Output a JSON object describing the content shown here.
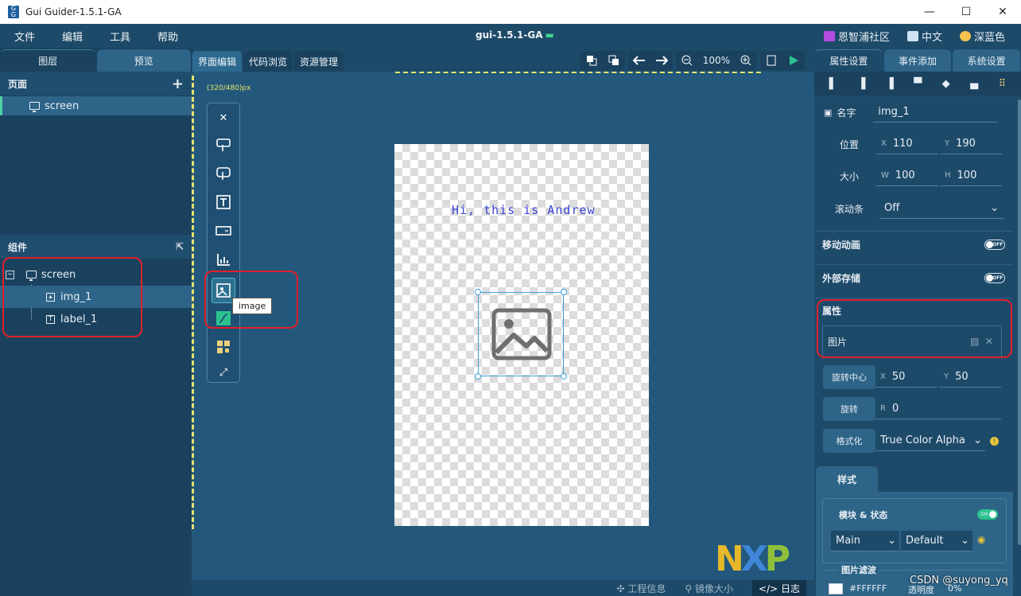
{
  "window": {
    "title": "Gui Guider-1.5.1-GA",
    "minimize": "—",
    "maximize": "☐",
    "close": "✕"
  },
  "menu": {
    "items": [
      "文件",
      "编辑",
      "工具",
      "帮助"
    ],
    "project": "gui-1.5.1-GA",
    "community": "恩智浦社区",
    "language": "中文",
    "theme": "深蓝色"
  },
  "left": {
    "tabs": [
      "图层",
      "预览"
    ],
    "pages_title": "页面",
    "pages": [
      "screen"
    ],
    "components_title": "组件",
    "tree": {
      "root": "screen",
      "children": [
        "img_1",
        "label_1"
      ]
    }
  },
  "center": {
    "tabs": [
      "界面编辑",
      "代码浏览",
      "资源管理"
    ],
    "zoom": "100%",
    "size_label": "(320/480)px",
    "tooltip": "image",
    "canvas_text": "Hi, this is Andrew",
    "logo": {
      "n": "N",
      "x": "X",
      "p": "P"
    },
    "status": {
      "project_info": "工程信息",
      "mirror_size": "镜像大小",
      "log": "日志"
    }
  },
  "right": {
    "tabs": [
      "属性设置",
      "事件添加",
      "系统设置"
    ],
    "name_label": "名字",
    "name_value": "img_1",
    "pos_label": "位置",
    "pos_x": "110",
    "pos_y": "190",
    "size_label": "大小",
    "size_w": "100",
    "size_h": "100",
    "scroll_label": "滚动条",
    "scroll_value": "Off",
    "move_anim": "移动动画",
    "ext_storage": "外部存储",
    "attr_title": "属性",
    "image_label": "图片",
    "rot_center": "旋转中心",
    "rot_x": "50",
    "rot_y": "50",
    "rotate": "旋转",
    "rotate_r": "0",
    "format": "格式化",
    "format_value": "True Color Alpha",
    "style_tab": "样式",
    "block_state": "模块 & 状态",
    "part_value": "Main",
    "state_value": "Default",
    "img_filter": "图片滤波",
    "filter_color": "#FFFFFF",
    "filter_opacity": "透明度",
    "filter_opacity_value": "0%"
  },
  "watermark": "CSDN @suyong_yq",
  "colors": {
    "accent": "#2cc28f",
    "highlight": "#e0202a",
    "panel": "#1e4a6a"
  }
}
